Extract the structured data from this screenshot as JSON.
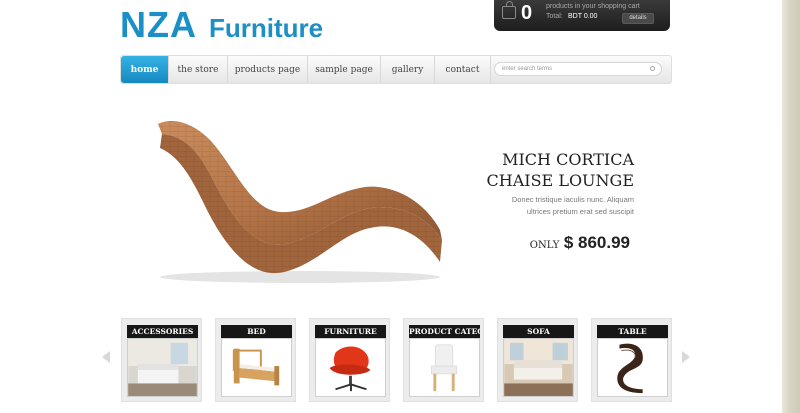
{
  "brand": {
    "name_part1": "NZA",
    "name_part2": "Furniture"
  },
  "cart": {
    "count": "0",
    "line1": "products in your shopping cart",
    "total_label": "Total:",
    "total_value": "BDT 0.00",
    "details_label": "details"
  },
  "nav": {
    "items": [
      {
        "label": "home",
        "active": true
      },
      {
        "label": "the store"
      },
      {
        "label": "products page"
      },
      {
        "label": "sample page"
      },
      {
        "label": "gallery"
      },
      {
        "label": "contact"
      }
    ]
  },
  "search": {
    "placeholder": "enter search terms"
  },
  "hero": {
    "title_line1": "MICH CORTICA",
    "title_line2": "CHAISE LOUNGE",
    "desc_line1": "Donec tristique iaculis nunc. Aliquam",
    "desc_line2": "ultrices pretium erat sed suscipit",
    "price_prefix": "ONLY",
    "price": "$ 860.99"
  },
  "categories": [
    {
      "label": "ACCESSORIES"
    },
    {
      "label": "BED"
    },
    {
      "label": "FURNITURE"
    },
    {
      "label": "PRODUCT CATEGORY"
    },
    {
      "label": "SOFA"
    },
    {
      "label": "TABLE"
    }
  ],
  "colors": {
    "accent": "#1c8fc6",
    "cart_bg": "#1d1d1d"
  }
}
